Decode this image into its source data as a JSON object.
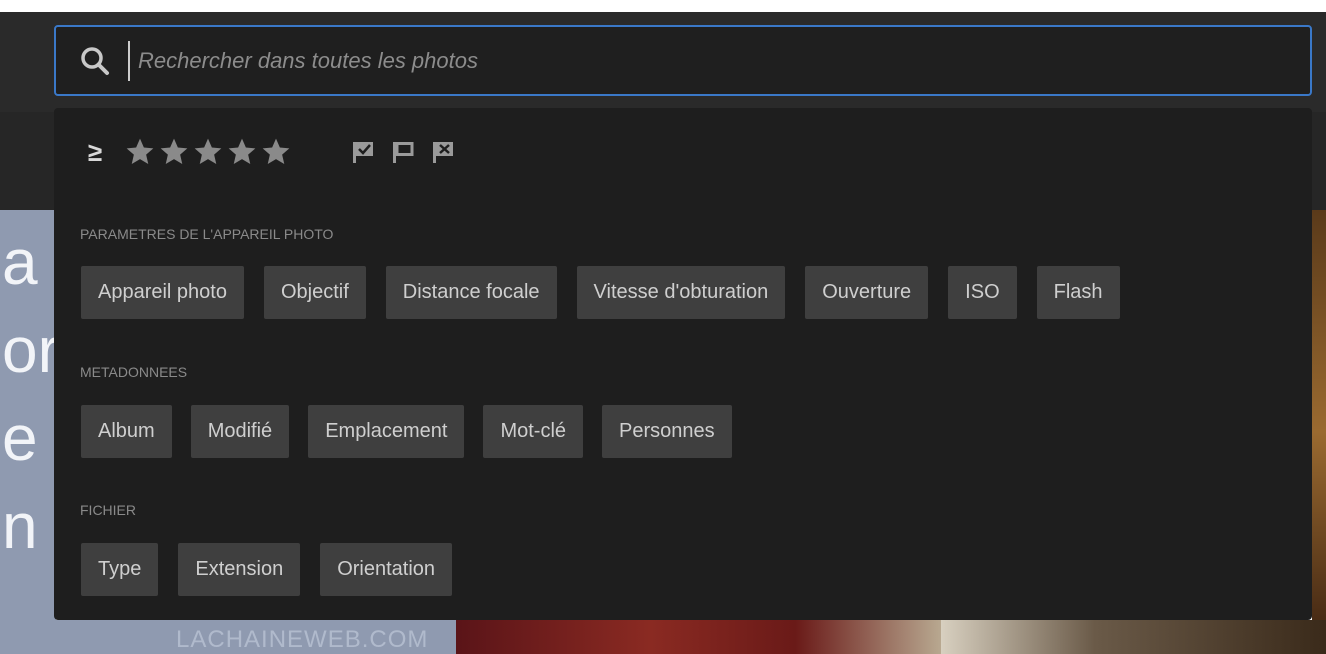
{
  "search": {
    "placeholder": "Rechercher dans toutes les photos",
    "icon": "search-icon"
  },
  "rating": {
    "operator": "≥",
    "stars": 5
  },
  "flags": [
    {
      "name": "flag-picked-icon"
    },
    {
      "name": "flag-unflagged-icon"
    },
    {
      "name": "flag-rejected-icon"
    }
  ],
  "sections": {
    "camera": {
      "label": "PARAMETRES DE L'APPAREIL PHOTO",
      "chips": [
        "Appareil photo",
        "Objectif",
        "Distance focale",
        "Vitesse d'obturation",
        "Ouverture",
        "ISO",
        "Flash"
      ]
    },
    "metadata": {
      "label": "METADONNEES",
      "chips": [
        "Album",
        "Modifié",
        "Emplacement",
        "Mot-clé",
        "Personnes"
      ]
    },
    "file": {
      "label": "FICHIER",
      "chips": [
        "Type",
        "Extension",
        "Orientation"
      ]
    }
  },
  "background": {
    "letters": [
      "a",
      "or",
      "e",
      "n"
    ],
    "watermark": "LACHAINEWEB.COM"
  },
  "colors": {
    "accent": "#3a78c8",
    "panel": "#1e1e1e",
    "chip": "#3f3f3f"
  }
}
